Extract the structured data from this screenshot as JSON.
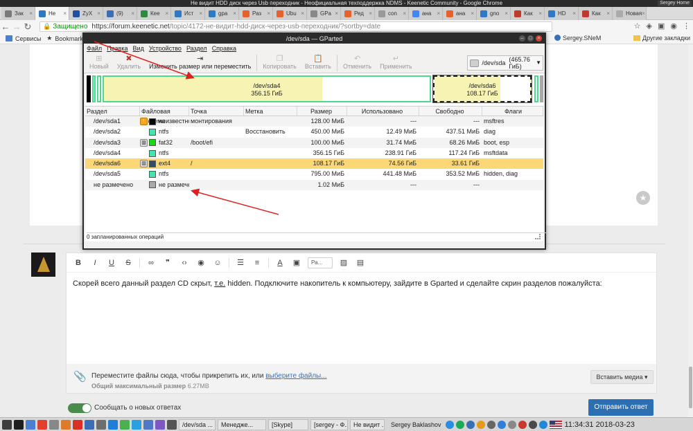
{
  "window": {
    "title": "Не видит HDD диск через Usb переходник - Неофициальная техподдержка NDMS - Keenetic Community - Google Chrome",
    "profile": "Sergey Home"
  },
  "tabs": [
    {
      "label": "Зак",
      "color": "#7a7a7a"
    },
    {
      "label": "Не",
      "color": "#2f78c4",
      "active": true
    },
    {
      "label": "ZyX",
      "color": "#1f4f9e"
    },
    {
      "label": "(9)",
      "color": "#3a6fb5"
    },
    {
      "label": "Кее",
      "color": "#2d8a3e"
    },
    {
      "label": "Ист",
      "color": "#2f78c4"
    },
    {
      "label": "gpa",
      "color": "#2f78c4"
    },
    {
      "label": "Раз",
      "color": "#e8602c"
    },
    {
      "label": "Ubu",
      "color": "#e8602c"
    },
    {
      "label": "GPa",
      "color": "#888888"
    },
    {
      "label": "Ред",
      "color": "#e8602c"
    },
    {
      "label": "con",
      "color": "#999999"
    },
    {
      "label": "ана",
      "color": "#4285f4"
    },
    {
      "label": "ана",
      "color": "#e8602c"
    },
    {
      "label": "gno",
      "color": "#2f78c4"
    },
    {
      "label": "Как",
      "color": "#c0392b"
    },
    {
      "label": "HD",
      "color": "#2f78c4"
    },
    {
      "label": "Как",
      "color": "#c0392b"
    },
    {
      "label": "Новая",
      "color": "#aaaaaa"
    }
  ],
  "address": {
    "secure_label": "Защищено",
    "host": "https://forum.keenetic.net",
    "path": "/topic/4172-не-видит-hdd-диск-через-usb-переходник/?sortby=date"
  },
  "bookmarks": {
    "services": "Сервисы",
    "bookmarks": "Bookmarks",
    "sergey": "Sergey.SNeM",
    "other": "Другие закладки"
  },
  "gparted": {
    "title": "/dev/sda — GParted",
    "menu": [
      "Файл",
      "Правка",
      "Вид",
      "Устройство",
      "Раздел",
      "Справка"
    ],
    "tools": [
      {
        "label": "Новый",
        "icon": "new-icon",
        "enabled": false
      },
      {
        "label": "Удалить",
        "icon": "delete-icon",
        "enabled": false
      },
      {
        "label": "Изменить размер или переместить",
        "icon": "resize-icon",
        "enabled": true
      },
      {
        "label": "Копировать",
        "icon": "copy-icon",
        "enabled": false
      },
      {
        "label": "Вставить",
        "icon": "paste-icon",
        "enabled": false
      },
      {
        "label": "Отменить",
        "icon": "undo-icon",
        "enabled": false
      },
      {
        "label": "Применить",
        "icon": "apply-icon",
        "enabled": false
      }
    ],
    "device": "/dev/sda",
    "device_size": "(465.76 ГиБ)",
    "map": {
      "sda4": {
        "name": "/dev/sda4",
        "size": "356.15 ГиБ"
      },
      "sda6": {
        "name": "/dev/sda6",
        "size": "108.17 ГиБ"
      }
    },
    "columns": [
      "Раздел",
      "Файловая система",
      "Точка монтирования",
      "Метка",
      "Размер",
      "Использовано",
      "Свободно",
      "Флаги"
    ],
    "rows": [
      {
        "part": "/dev/sda1",
        "fs": "неизвестно",
        "mount": "",
        "label": "",
        "size": "128.00 МиБ",
        "used": "---",
        "free": "---",
        "flags": "msftres",
        "color": "#000000",
        "lock": "warn"
      },
      {
        "part": "/dev/sda2",
        "fs": "ntfs",
        "mount": "",
        "label": "Восстановить",
        "size": "450.00 МиБ",
        "used": "12.49 МиБ",
        "free": "437.51 МиБ",
        "flags": "diag",
        "color": "#42e5ac",
        "lock": ""
      },
      {
        "part": "/dev/sda3",
        "fs": "fat32",
        "mount": "/boot/efi",
        "label": "",
        "size": "100.00 МиБ",
        "used": "31.74 МиБ",
        "free": "68.26 МиБ",
        "flags": "boot, esp",
        "color": "#18d918",
        "lock": "key"
      },
      {
        "part": "/dev/sda4",
        "fs": "ntfs",
        "mount": "",
        "label": "",
        "size": "356.15 ГиБ",
        "used": "238.91 ГиБ",
        "free": "117.24 ГиБ",
        "flags": "msftdata",
        "color": "#42e5ac",
        "lock": ""
      },
      {
        "part": "/dev/sda6",
        "fs": "ext4",
        "mount": "/",
        "label": "",
        "size": "108.17 ГиБ",
        "used": "74.56 ГиБ",
        "free": "33.61 ГиБ",
        "flags": "",
        "color": "#314e6c",
        "lock": "key",
        "selected": true
      },
      {
        "part": "/dev/sda5",
        "fs": "ntfs",
        "mount": "",
        "label": "",
        "size": "795.00 МиБ",
        "used": "441.48 МиБ",
        "free": "353.52 МиБ",
        "flags": "hidden, diag",
        "color": "#42e5ac",
        "lock": ""
      },
      {
        "part": "не размечено",
        "fs": "не размечено",
        "mount": "",
        "label": "",
        "size": "1.02 МиБ",
        "used": "---",
        "free": "---",
        "flags": "",
        "color": "#a9a9a9",
        "lock": ""
      }
    ],
    "status": "0 запланированных операций"
  },
  "editor": {
    "font_select": "Ра...",
    "text_before": "Скорей всего данный раздел CD скрыт, ",
    "text_u": "т.е.",
    "text_after": " hidden. Подключите накопитель к компьютеру, зайдите в Gparted и сделайте скрин разделов пожалуйста:"
  },
  "attach": {
    "text": "Переместите файлы сюда, чтобы прикрепить их, или ",
    "link": "выберите файлы...",
    "limit_label": "Общий максимальный размер",
    "limit_value": "6.27MB",
    "insert_media": "Вставить медиа ▾"
  },
  "notify": {
    "label": "Сообщать о новых ответах",
    "on": true
  },
  "send": "Отправить ответ",
  "taskbar": {
    "tasks": [
      "/dev/sda ...",
      "Менедже...",
      "[Skype]",
      "[sergey - Ф...",
      "Не видит ..."
    ],
    "user": "Sergey Baklashov",
    "clock": "11:34:31  2018-03-23"
  }
}
